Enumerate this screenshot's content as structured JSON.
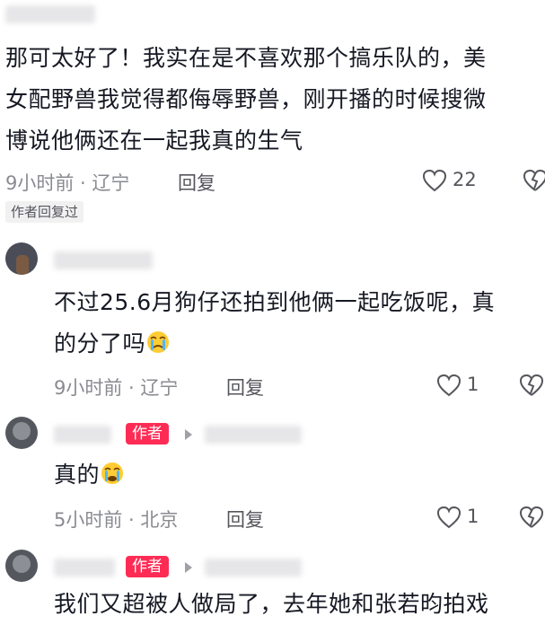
{
  "comments": [
    {
      "text_lines": [
        "那可太好了！我实在是不喜欢那个搞乐队的，美",
        "女配野兽我觉得都侮辱野兽，刚开播的时候搜微",
        "博说他俩还在一起我真的生气"
      ],
      "meta": "9小时前 · 辽宁",
      "reply_label": "回复",
      "likes": "22",
      "author_replied": "作者回复过"
    }
  ],
  "replies": [
    {
      "text_lines": [
        "不过25.6月狗仔还拍到他俩一起吃饭呢，真",
        "的分了吗"
      ],
      "meta": "9小时前 · 辽宁",
      "reply_label": "回复",
      "likes": "1"
    },
    {
      "badge": "作者",
      "text": "真的",
      "meta": "5小时前 · 北京",
      "reply_label": "回复",
      "likes": "1"
    },
    {
      "badge": "作者",
      "text": "我们又超被人做局了，去年她和张若昀拍戏"
    }
  ],
  "colors": {
    "accent": "#fe2c55",
    "meta": "#8a8b91",
    "text": "#161823"
  },
  "icons": [
    "heart-icon",
    "dislike-icon",
    "reply-arrow-icon",
    "crying-emoji-icon"
  ]
}
